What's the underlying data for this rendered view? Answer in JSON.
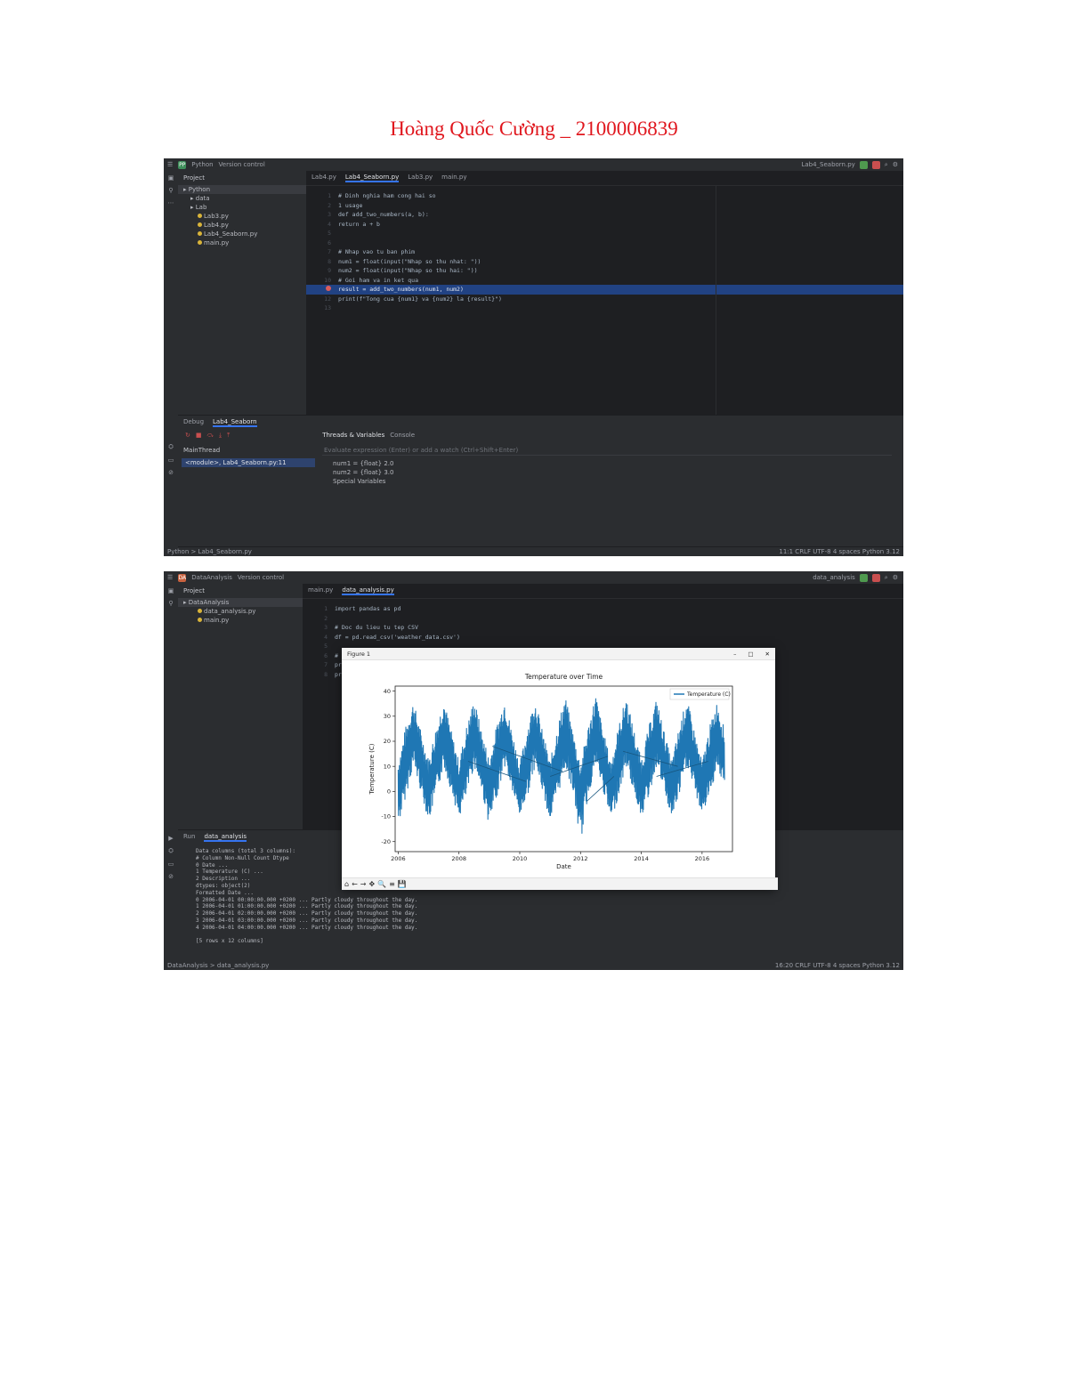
{
  "document_title": "Hoàng Quốc Cường _ 2100006839",
  "shot1": {
    "window": {
      "project_badge": "PP",
      "project_name": "Python",
      "vcs": "Version control",
      "run_config": "Lab4_Seaborn.py"
    },
    "project_panel": {
      "header": "Project",
      "items": [
        {
          "label": "Python",
          "type": "folder"
        },
        {
          "label": "data",
          "type": "folder"
        },
        {
          "label": "Lab",
          "type": "folder"
        },
        {
          "label": "Lab3.py",
          "type": "file"
        },
        {
          "label": "Lab4.py",
          "type": "file"
        },
        {
          "label": "Lab4_Seaborn.py",
          "type": "file"
        },
        {
          "label": "main.py",
          "type": "file"
        }
      ]
    },
    "editor_tabs": [
      "Lab4.py",
      "Lab4_Seaborn.py",
      "Lab3.py",
      "main.py"
    ],
    "code": [
      {
        "ln": "1",
        "text": "# Dinh nghia ham cong hai so"
      },
      {
        "ln": "2",
        "text": "1 usage"
      },
      {
        "ln": "3",
        "text": "def add_two_numbers(a, b):"
      },
      {
        "ln": "4",
        "text": "    return a + b"
      },
      {
        "ln": "5",
        "text": ""
      },
      {
        "ln": "6",
        "text": ""
      },
      {
        "ln": "7",
        "text": "# Nhap vao tu ban phim"
      },
      {
        "ln": "8",
        "text": "num1 = float(input(\"Nhap so thu nhat: \"))"
      },
      {
        "ln": "9",
        "text": "num2 = float(input(\"Nhap so thu hai: \"))"
      },
      {
        "ln": "10",
        "text": "# Goi ham va in ket qua"
      },
      {
        "ln": "11",
        "text": "result = add_two_numbers(num1, num2)",
        "highlight": true,
        "breakpoint": true
      },
      {
        "ln": "12",
        "text": "print(f\"Tong cua {num1} va {num2} la {result}\")"
      },
      {
        "ln": "13",
        "text": ""
      }
    ],
    "debug_panel": {
      "tabs": [
        "Debug",
        "Lab4_Seaborn"
      ],
      "frames_label": "MainThread",
      "frame_item": "<module>, Lab4_Seaborn.py:11",
      "sub_tabs": [
        "Threads & Variables",
        "Console"
      ],
      "eval_placeholder": "Evaluate expression (Enter) or add a watch (Ctrl+Shift+Enter)",
      "variables": [
        "num1 = {float} 2.0",
        "num2 = {float} 3.0",
        "Special Variables"
      ]
    },
    "status_left": "Python > Lab4_Seaborn.py",
    "status_right": "11:1  CRLF  UTF-8  4 spaces  Python 3.12"
  },
  "shot2": {
    "window": {
      "project_badge": "DA",
      "project_name": "DataAnalysis",
      "vcs": "Version control",
      "run_config": "data_analysis"
    },
    "project_panel": {
      "header": "Project",
      "items": [
        {
          "label": "DataAnalysis",
          "type": "folder"
        },
        {
          "label": "data_analysis.py",
          "type": "file"
        },
        {
          "label": "main.py",
          "type": "file"
        }
      ]
    },
    "editor_tabs": [
      "main.py",
      "data_analysis.py"
    ],
    "code": [
      {
        "ln": "1",
        "text": "import pandas as pd"
      },
      {
        "ln": "2",
        "text": ""
      },
      {
        "ln": "3",
        "text": "# Doc du lieu tu tep CSV"
      },
      {
        "ln": "4",
        "text": "df = pd.read_csv('weather_data.csv')"
      },
      {
        "ln": "5",
        "text": ""
      },
      {
        "ln": "6",
        "text": "# Hien thi thong tin co ban ve du lieu"
      },
      {
        "ln": "7",
        "text": "print(df.head())"
      },
      {
        "ln": "8",
        "text": "print(df.info())"
      }
    ],
    "run_panel": {
      "tabs": [
        "Run",
        "data_analysis"
      ],
      "console": [
        "Data columns (total 3 columns):",
        " #   Column            Non-Null Count  Dtype",
        " 0   Date              ...",
        " 1   Temperature (C)   ...",
        " 2   Description       ...",
        "dtypes: object(2)",
        "                 Formatted Date   ...",
        "0 2006-04-01 00:00:00.000 +0200  ...  Partly cloudy throughout the day.",
        "1 2006-04-01 01:00:00.000 +0200  ...  Partly cloudy throughout the day.",
        "2 2006-04-01 02:00:00.000 +0200  ...  Partly cloudy throughout the day.",
        "3 2006-04-01 03:00:00.000 +0200  ...  Partly cloudy throughout the day.",
        "4 2006-04-01 04:00:00.000 +0200  ...  Partly cloudy throughout the day.",
        "",
        "[5 rows x 12 columns]"
      ]
    },
    "status_left": "DataAnalysis > data_analysis.py",
    "status_right": "16:20  CRLF  UTF-8  4 spaces  Python 3.12"
  },
  "figure": {
    "window_title": "Figure 1",
    "controls": [
      "–",
      "□",
      "✕"
    ],
    "toolbar": [
      "⌂",
      "←",
      "→",
      "✥",
      "🔍",
      "≡",
      "💾"
    ]
  },
  "chart_data": {
    "type": "line",
    "title": "Temperature over Time",
    "xlabel": "Date",
    "ylabel": "Temperature (C)",
    "legend": [
      "Temperature (C)"
    ],
    "legend_position": "top-right",
    "series_color": "#1f77b4",
    "xlim": [
      2005.9,
      2017.0
    ],
    "ylim": [
      -24,
      42
    ],
    "x_ticks": [
      2006,
      2008,
      2010,
      2012,
      2014,
      2016
    ],
    "x_tick_labels": [
      "2006",
      "2008",
      "2010",
      "2012",
      "2014",
      "2016"
    ],
    "y_ticks": [
      -20,
      -10,
      0,
      10,
      20,
      30,
      40
    ],
    "grid": false,
    "series": [
      {
        "name": "Temperature (C)",
        "x": [
          2006.0,
          2006.25,
          2006.5,
          2006.75,
          2007.0,
          2007.25,
          2007.5,
          2007.75,
          2008.0,
          2008.25,
          2008.5,
          2008.75,
          2009.0,
          2009.25,
          2009.5,
          2009.75,
          2010.0,
          2010.25,
          2010.5,
          2010.75,
          2011.0,
          2011.25,
          2011.5,
          2011.75,
          2012.0,
          2012.25,
          2012.5,
          2012.75,
          2013.0,
          2013.25,
          2013.5,
          2013.75,
          2014.0,
          2014.25,
          2014.5,
          2014.75,
          2015.0,
          2015.25,
          2015.5,
          2015.75,
          2016.0,
          2016.25,
          2016.5,
          2016.75
        ],
        "y_mean": [
          1,
          12,
          24,
          12,
          1,
          12,
          24,
          12,
          1,
          12,
          24,
          12,
          1,
          12,
          24,
          12,
          0,
          12,
          24,
          12,
          1,
          12,
          24,
          12,
          0,
          12,
          24,
          12,
          1,
          12,
          24,
          12,
          1,
          12,
          24,
          12,
          1,
          12,
          24,
          12,
          1,
          12,
          24,
          12
        ],
        "y_max": [
          12,
          26,
          36,
          24,
          13,
          26,
          37,
          24,
          12,
          26,
          37,
          24,
          13,
          27,
          37,
          24,
          11,
          26,
          37,
          24,
          12,
          27,
          38,
          24,
          11,
          26,
          39,
          24,
          12,
          26,
          38,
          25,
          13,
          26,
          37,
          24,
          12,
          26,
          37,
          24,
          12,
          26,
          36,
          24
        ],
        "y_min": [
          -14,
          -2,
          10,
          0,
          -12,
          -2,
          10,
          0,
          -11,
          -2,
          10,
          0,
          -14,
          -2,
          10,
          0,
          -10,
          -2,
          10,
          0,
          -12,
          -2,
          10,
          0,
          -21,
          -2,
          10,
          0,
          -12,
          -2,
          10,
          0,
          -10,
          -2,
          10,
          0,
          -11,
          -2,
          10,
          0,
          -9,
          -2,
          10,
          0
        ]
      }
    ]
  }
}
